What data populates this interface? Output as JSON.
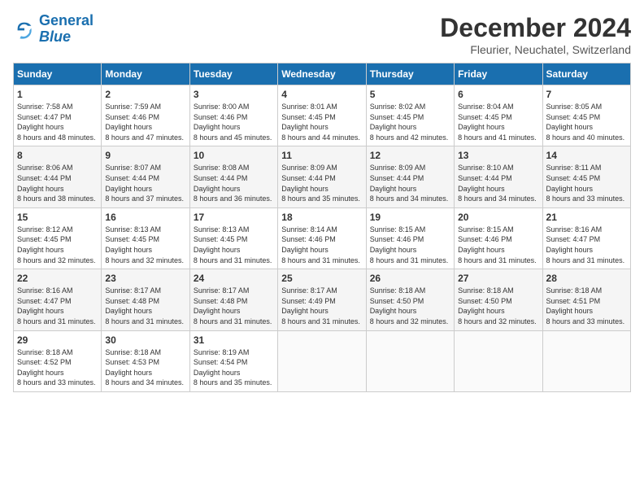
{
  "header": {
    "logo_line1": "General",
    "logo_line2": "Blue",
    "month": "December 2024",
    "location": "Fleurier, Neuchatel, Switzerland"
  },
  "weekdays": [
    "Sunday",
    "Monday",
    "Tuesday",
    "Wednesday",
    "Thursday",
    "Friday",
    "Saturday"
  ],
  "weeks": [
    [
      {
        "day": "1",
        "sunrise": "7:58 AM",
        "sunset": "4:47 PM",
        "daylight": "8 hours and 48 minutes."
      },
      {
        "day": "2",
        "sunrise": "7:59 AM",
        "sunset": "4:46 PM",
        "daylight": "8 hours and 47 minutes."
      },
      {
        "day": "3",
        "sunrise": "8:00 AM",
        "sunset": "4:46 PM",
        "daylight": "8 hours and 45 minutes."
      },
      {
        "day": "4",
        "sunrise": "8:01 AM",
        "sunset": "4:45 PM",
        "daylight": "8 hours and 44 minutes."
      },
      {
        "day": "5",
        "sunrise": "8:02 AM",
        "sunset": "4:45 PM",
        "daylight": "8 hours and 42 minutes."
      },
      {
        "day": "6",
        "sunrise": "8:04 AM",
        "sunset": "4:45 PM",
        "daylight": "8 hours and 41 minutes."
      },
      {
        "day": "7",
        "sunrise": "8:05 AM",
        "sunset": "4:45 PM",
        "daylight": "8 hours and 40 minutes."
      }
    ],
    [
      {
        "day": "8",
        "sunrise": "8:06 AM",
        "sunset": "4:44 PM",
        "daylight": "8 hours and 38 minutes."
      },
      {
        "day": "9",
        "sunrise": "8:07 AM",
        "sunset": "4:44 PM",
        "daylight": "8 hours and 37 minutes."
      },
      {
        "day": "10",
        "sunrise": "8:08 AM",
        "sunset": "4:44 PM",
        "daylight": "8 hours and 36 minutes."
      },
      {
        "day": "11",
        "sunrise": "8:09 AM",
        "sunset": "4:44 PM",
        "daylight": "8 hours and 35 minutes."
      },
      {
        "day": "12",
        "sunrise": "8:09 AM",
        "sunset": "4:44 PM",
        "daylight": "8 hours and 34 minutes."
      },
      {
        "day": "13",
        "sunrise": "8:10 AM",
        "sunset": "4:44 PM",
        "daylight": "8 hours and 34 minutes."
      },
      {
        "day": "14",
        "sunrise": "8:11 AM",
        "sunset": "4:45 PM",
        "daylight": "8 hours and 33 minutes."
      }
    ],
    [
      {
        "day": "15",
        "sunrise": "8:12 AM",
        "sunset": "4:45 PM",
        "daylight": "8 hours and 32 minutes."
      },
      {
        "day": "16",
        "sunrise": "8:13 AM",
        "sunset": "4:45 PM",
        "daylight": "8 hours and 32 minutes."
      },
      {
        "day": "17",
        "sunrise": "8:13 AM",
        "sunset": "4:45 PM",
        "daylight": "8 hours and 31 minutes."
      },
      {
        "day": "18",
        "sunrise": "8:14 AM",
        "sunset": "4:46 PM",
        "daylight": "8 hours and 31 minutes."
      },
      {
        "day": "19",
        "sunrise": "8:15 AM",
        "sunset": "4:46 PM",
        "daylight": "8 hours and 31 minutes."
      },
      {
        "day": "20",
        "sunrise": "8:15 AM",
        "sunset": "4:46 PM",
        "daylight": "8 hours and 31 minutes."
      },
      {
        "day": "21",
        "sunrise": "8:16 AM",
        "sunset": "4:47 PM",
        "daylight": "8 hours and 31 minutes."
      }
    ],
    [
      {
        "day": "22",
        "sunrise": "8:16 AM",
        "sunset": "4:47 PM",
        "daylight": "8 hours and 31 minutes."
      },
      {
        "day": "23",
        "sunrise": "8:17 AM",
        "sunset": "4:48 PM",
        "daylight": "8 hours and 31 minutes."
      },
      {
        "day": "24",
        "sunrise": "8:17 AM",
        "sunset": "4:48 PM",
        "daylight": "8 hours and 31 minutes."
      },
      {
        "day": "25",
        "sunrise": "8:17 AM",
        "sunset": "4:49 PM",
        "daylight": "8 hours and 31 minutes."
      },
      {
        "day": "26",
        "sunrise": "8:18 AM",
        "sunset": "4:50 PM",
        "daylight": "8 hours and 32 minutes."
      },
      {
        "day": "27",
        "sunrise": "8:18 AM",
        "sunset": "4:50 PM",
        "daylight": "8 hours and 32 minutes."
      },
      {
        "day": "28",
        "sunrise": "8:18 AM",
        "sunset": "4:51 PM",
        "daylight": "8 hours and 33 minutes."
      }
    ],
    [
      {
        "day": "29",
        "sunrise": "8:18 AM",
        "sunset": "4:52 PM",
        "daylight": "8 hours and 33 minutes."
      },
      {
        "day": "30",
        "sunrise": "8:18 AM",
        "sunset": "4:53 PM",
        "daylight": "8 hours and 34 minutes."
      },
      {
        "day": "31",
        "sunrise": "8:19 AM",
        "sunset": "4:54 PM",
        "daylight": "8 hours and 35 minutes."
      },
      null,
      null,
      null,
      null
    ]
  ]
}
